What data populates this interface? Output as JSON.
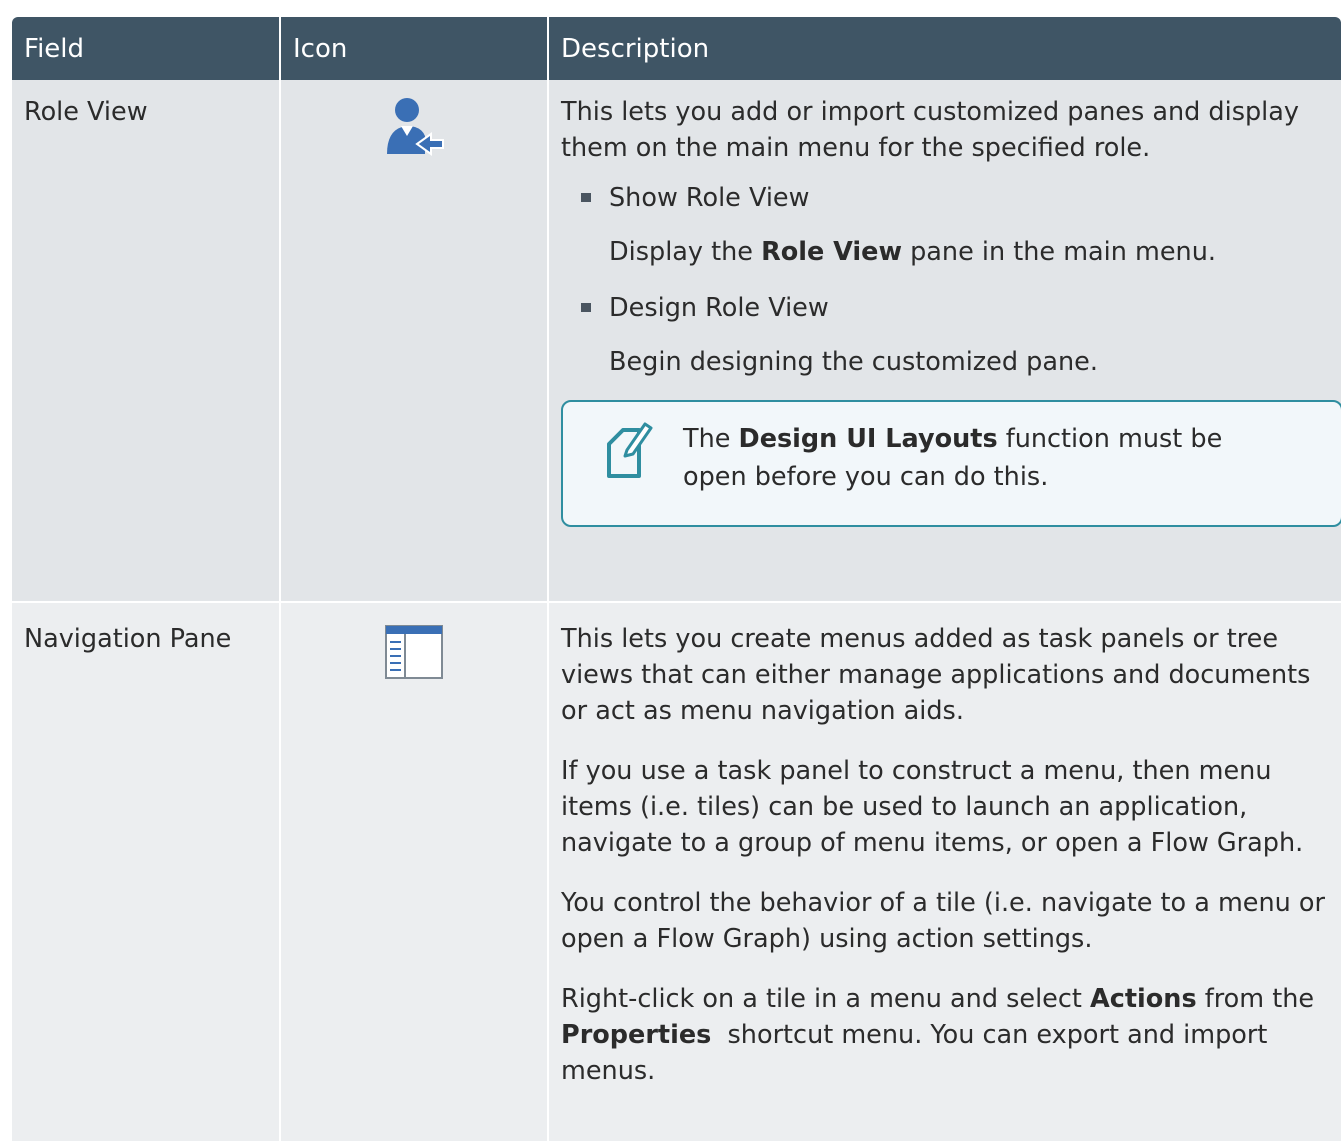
{
  "headers": {
    "field": "Field",
    "icon": "Icon",
    "description": "Description"
  },
  "rows": [
    {
      "field": "Role View",
      "icon": "user-arrow-icon",
      "description_intro": "This lets you add or import customized panes and display them on the main menu for the specified role.",
      "options": [
        {
          "title": "Show Role View",
          "desc_before": "Display the ",
          "desc_bold": "Role View",
          "desc_after": " pane in the main menu."
        },
        {
          "title": "Design Role View",
          "desc": "Begin designing the customized pane."
        }
      ],
      "note": {
        "before": "The ",
        "bold": "Design UI Layouts",
        "after": " function must be open before you can do this.",
        "icon": "pencil-note-icon"
      }
    },
    {
      "field": "Navigation Pane",
      "icon": "navigation-pane-icon",
      "para1": "This lets you create menus added as task panels or tree views that can either manage applications and documents or act as menu navigation aids.",
      "para2": "If you use a task panel to construct a menu, then menu items (i.e. tiles) can be used to launch an application, navigate to a group of menu items, or open a Flow Graph.",
      "para3": "You control the behavior of a tile (i.e. navigate to a menu or open a Flow Graph) using action settings.",
      "para4": {
        "t1": "Right-click on a tile in a menu and select ",
        "b1": "Actions",
        "t2": " from the ",
        "b2": "Properties",
        "t3": "  shortcut menu. You can export and import menus."
      }
    }
  ],
  "colors": {
    "header_bg": "#3f5565",
    "row_a_bg": "#e2e5e8",
    "row_b_bg": "#eceef0",
    "note_border": "#2f8ea0",
    "icon_blue": "#3a6fb5"
  }
}
